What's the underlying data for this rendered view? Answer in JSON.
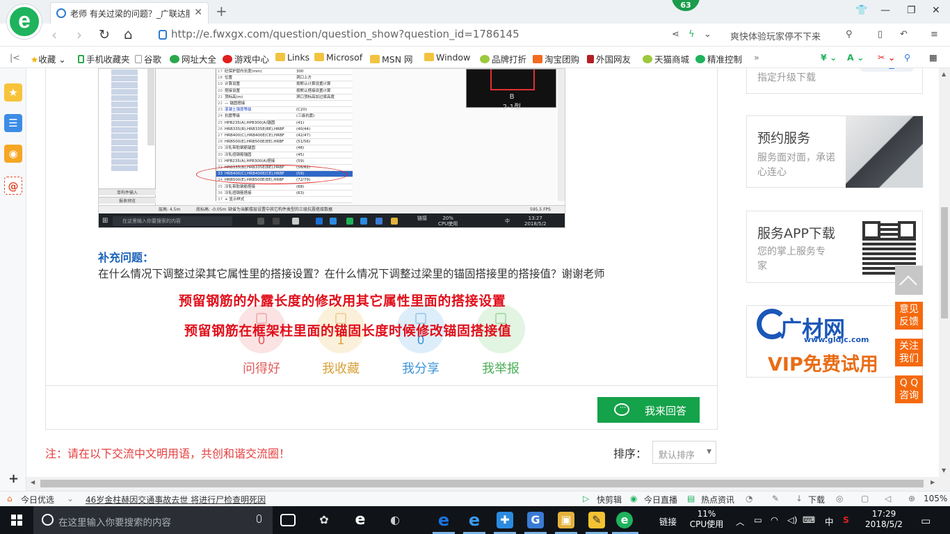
{
  "browser": {
    "tab_title": "老师 有关过梁的问题？_广联达服",
    "url": "http://e.fwxgx.com/question/question_show?question_id=1786145",
    "badge": "63",
    "promo": "爽快体验玩家停不下来"
  },
  "bookmarks": [
    "收藏",
    "手机收藏夹",
    "谷歌",
    "网址大全",
    "游戏中心",
    "Links",
    "Microsof",
    "MSN 网",
    "Window",
    "品牌打折",
    "淘宝团购",
    "外国网友",
    "天猫商城",
    "精准控制"
  ],
  "screenshot": {
    "tree_buttons": [
      "单构件输入",
      "报表预览"
    ],
    "rows": [
      {
        "n": "17",
        "name": "砼保护层内长度(mm)",
        "val": "300"
      },
      {
        "n": "18",
        "name": "位置",
        "val": "洞口上方"
      },
      {
        "n": "19",
        "name": "计算设置",
        "val": "按默认计算设置计算"
      },
      {
        "n": "20",
        "name": "搭接设置",
        "val": "按默认搭接设置计算"
      },
      {
        "n": "21",
        "name": "顶标高(m)",
        "val": "洞口顶标高加过梁高度"
      },
      {
        "n": "22",
        "name": "— 锚固搭接",
        "val": ""
      },
      {
        "n": "23",
        "name": "混凝土强度等级",
        "val": "(C20)"
      },
      {
        "n": "24",
        "name": "抗震等级",
        "val": "(三级抗震)"
      },
      {
        "n": "25",
        "name": "HPB235(A),HPB300(A)锚固",
        "val": "(41)"
      },
      {
        "n": "26",
        "name": "HRB335(B),HRB335E(BE),HRBF",
        "val": "(40/44)"
      },
      {
        "n": "27",
        "name": "HRB400(C),HRB400E(CE),HRBF",
        "val": "(42/47)"
      },
      {
        "n": "28",
        "name": "HRB500(E),HRB500E(EE),HRBF",
        "val": "(51/56)"
      },
      {
        "n": "29",
        "name": "冷轧带肋钢筋锚固",
        "val": "(48)"
      },
      {
        "n": "30",
        "name": "冷轧扭钢筋锚固",
        "val": "(45)"
      },
      {
        "n": "31",
        "name": "HPB235(A),HPB300(A)搭接",
        "val": "(59)"
      },
      {
        "n": "32",
        "name": "HRB335(B),HRB335E(BE),HRBF",
        "val": "(56/62)"
      },
      {
        "n": "33",
        "name": "HRB400(C),HRB400E(CE),HRBF",
        "val": "(59)"
      },
      {
        "n": "34",
        "name": "HRB500(E),HRB500E(EE),HRBF",
        "val": "(72/79)"
      },
      {
        "n": "35",
        "name": "冷轧带肋钢筋搭接",
        "val": "(68)"
      },
      {
        "n": "36",
        "name": "冷轧扭钢筋搭接",
        "val": "(63)"
      },
      {
        "n": "37",
        "name": "+ 显示样式",
        "val": ""
      }
    ],
    "preview_label": "2-1型",
    "preview_letter": "B",
    "status_left": "层高: 4.5m",
    "status_mid": "底标高: -0.05m",
    "status_zero": "0",
    "status_msg": "缺省为当前楼层设置中其它构件类型的三级抗震搭接数据",
    "status_fps": "595.5 FPS",
    "taskbar_search": "在这里输入你要搜索的内容",
    "taskbar_cpu": "20%",
    "taskbar_cpu_label": "CPU使用",
    "taskbar_link": "链接",
    "taskbar_time": "13:27",
    "taskbar_date": "2018/5/2",
    "taskbar_lang": "中"
  },
  "question": {
    "supp_title": "补充问题：",
    "supp_text": "在什么情况下调整过梁其它属性里的搭接设置？在什么情况下调整过梁里的锚固搭接里的搭接值？谢谢老师",
    "answer_line1": "预留钢筋的外露长度的修改用其它属性里面的搭接设置",
    "answer_line2": "预留钢筋在框架柱里面的锚固长度时候修改锚固搭接值",
    "actions": [
      {
        "label": "问得好",
        "count": "0",
        "color": "#e25c5c",
        "bg": "#fbe3e3"
      },
      {
        "label": "我收藏",
        "count": "1",
        "color": "#d9a13a",
        "bg": "#fbf0d9"
      },
      {
        "label": "我分享",
        "count": "0",
        "color": "#3d94d8",
        "bg": "#ddeefa"
      },
      {
        "label": "我举报",
        "count": "",
        "color": "#4aae57",
        "bg": "#e2f4e2"
      }
    ],
    "answer_button": "我来回答",
    "notice": "注：请在以下交流中文明用语，共创和谐交流圈！",
    "sort_label": "排序：",
    "sort_value": "默认排序"
  },
  "right": {
    "upgrade": "指定升级下载",
    "service_title": "预约服务",
    "service_desc": "服务面对面，承诺心连心",
    "app_title": "服务APP下载",
    "app_desc": "您的掌上服务专家",
    "ad_brand": "广材网",
    "ad_url": "www.gldjc.com",
    "ad_vip": "VIP免费试用",
    "float": [
      "意见反馈",
      "关注我们",
      "Q Q咨询"
    ]
  },
  "statusbar": {
    "today": "今日优选",
    "news": "46岁金柱赫因交通事故去世 将进行尸检查明死因",
    "kuaijian": "快剪辑",
    "live": "今日直播",
    "hot": "热点资讯",
    "download": "下载",
    "zoom": "105%"
  },
  "taskbar": {
    "search": "在这里输入你要搜索的内容",
    "link": "链接",
    "cpu": "11%",
    "cpu_label": "CPU使用",
    "lang": "中",
    "time": "17:29",
    "date": "2018/5/2"
  },
  "colors": {
    "accent_green": "#14a24a",
    "float_orange": "#f5690d",
    "red_text": "#e00e1a",
    "link_blue": "#1c62b9"
  }
}
